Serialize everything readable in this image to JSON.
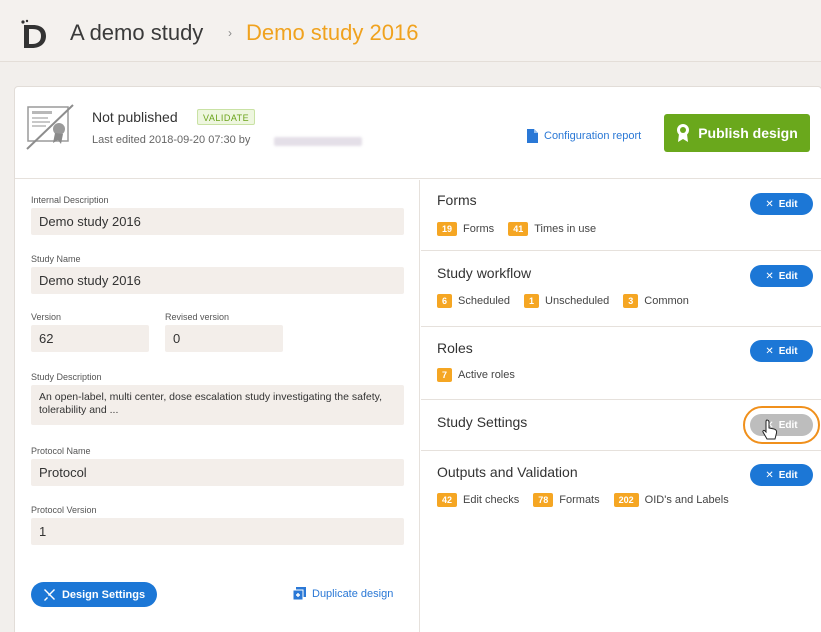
{
  "breadcrumb": {
    "root": "A demo study",
    "separator": "›",
    "current": "Demo study 2016"
  },
  "status": {
    "title": "Not published",
    "validate_label": "VALIDATE",
    "last_edited": "Last edited 2018-09-20 07:30 by"
  },
  "actions": {
    "config_report": "Configuration report",
    "publish": "Publish design",
    "design_settings": "Design Settings",
    "duplicate": "Duplicate design"
  },
  "fields": {
    "internal_description": {
      "label": "Internal Description",
      "value": "Demo study 2016"
    },
    "study_name": {
      "label": "Study Name",
      "value": "Demo study 2016"
    },
    "version": {
      "label": "Version",
      "value": "62"
    },
    "revised_version": {
      "label": "Revised version",
      "value": "0"
    },
    "study_description": {
      "label": "Study Description",
      "value": "An open-label, multi center, dose escalation study investigating the safety, tolerability and ..."
    },
    "protocol_name": {
      "label": "Protocol Name",
      "value": "Protocol"
    },
    "protocol_version": {
      "label": "Protocol Version",
      "value": "1"
    }
  },
  "sections": {
    "forms": {
      "title": "Forms",
      "edit": "Edit",
      "stats": [
        {
          "count": "19",
          "label": "Forms"
        },
        {
          "count": "41",
          "label": "Times in use"
        }
      ]
    },
    "workflow": {
      "title": "Study workflow",
      "edit": "Edit",
      "stats": [
        {
          "count": "6",
          "label": "Scheduled"
        },
        {
          "count": "1",
          "label": "Unscheduled"
        },
        {
          "count": "3",
          "label": "Common"
        }
      ]
    },
    "roles": {
      "title": "Roles",
      "edit": "Edit",
      "stats": [
        {
          "count": "7",
          "label": "Active roles"
        }
      ]
    },
    "settings": {
      "title": "Study Settings",
      "edit": "Edit"
    },
    "outputs": {
      "title": "Outputs and Validation",
      "edit": "Edit",
      "stats": [
        {
          "count": "42",
          "label": "Edit checks"
        },
        {
          "count": "78",
          "label": "Formats"
        },
        {
          "count": "202",
          "label": "OID's and Labels"
        }
      ]
    }
  },
  "colors": {
    "accent_orange": "#f0a21e",
    "primary_blue": "#1c77d6",
    "publish_green": "#6aa81c",
    "badge_orange": "#f5a623"
  },
  "icons": {
    "logo": "viedoc-logo",
    "certificate": "certificate-icon",
    "document": "document-icon",
    "award": "award-ribbon-icon",
    "tools": "tools-icon",
    "duplicate": "duplicate-icon",
    "cursor": "hand-cursor"
  }
}
